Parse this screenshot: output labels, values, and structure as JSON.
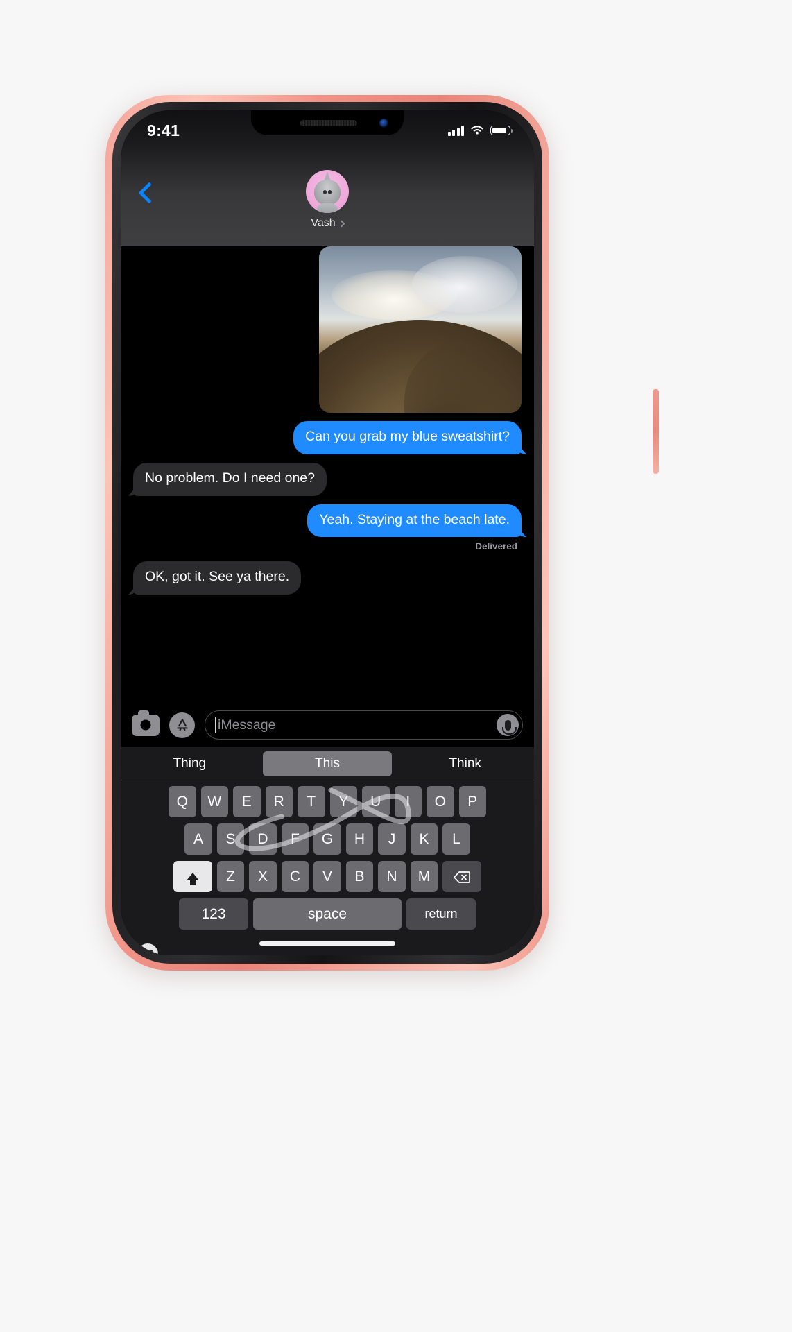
{
  "status_bar": {
    "time": "9:41",
    "signal_icon": "cellular-signal-icon",
    "wifi_icon": "wifi-icon",
    "battery_icon": "battery-icon"
  },
  "nav": {
    "back_icon": "back-chevron-icon",
    "contact_name": "Vash",
    "contact_chevron_icon": "chevron-right-icon",
    "avatar_icon": "memoji-shark-avatar"
  },
  "thread": {
    "attachment": {
      "type": "photo",
      "alt": "Photo of a brown hill under a cloudy sky"
    },
    "messages": [
      {
        "text": "Can you grab my blue sweatshirt?",
        "side": "out"
      },
      {
        "text": "No problem. Do I need one?",
        "side": "in"
      },
      {
        "text": "Yeah. Staying at the beach late.",
        "side": "out"
      },
      {
        "text": "OK, got it. See ya there.",
        "side": "in"
      }
    ],
    "delivered_label": "Delivered"
  },
  "composer": {
    "camera_icon": "camera-icon",
    "appstore_icon": "app-store-icon",
    "placeholder": "iMessage",
    "value": "",
    "mic_icon": "microphone-icon"
  },
  "keyboard": {
    "predictions": [
      {
        "label": "Thing",
        "selected": false
      },
      {
        "label": "This",
        "selected": true
      },
      {
        "label": "Think",
        "selected": false
      }
    ],
    "row1": [
      "Q",
      "W",
      "E",
      "R",
      "T",
      "Y",
      "U",
      "I",
      "O",
      "P"
    ],
    "row2": [
      "A",
      "S",
      "D",
      "F",
      "G",
      "H",
      "J",
      "K",
      "L"
    ],
    "row3": [
      "Z",
      "X",
      "C",
      "V",
      "B",
      "N",
      "M"
    ],
    "shift_icon": "shift-up-arrow-icon",
    "delete_icon": "delete-backspace-icon",
    "numbers_key": "123",
    "space_key": "space",
    "return_key": "return",
    "emoji_icon": "emoji-smiley-icon",
    "dictation_icon": "microphone-icon",
    "swipe_trail": "quickpath-swipe-trail"
  },
  "colors": {
    "accent_blue": "#1f8bff",
    "back_blue": "#0a84ff",
    "incoming_bubble": "#2b2b2d",
    "key_gray": "#6c6c70",
    "keyboard_bg": "#1a1a1c",
    "device_body": "#f0988c"
  }
}
